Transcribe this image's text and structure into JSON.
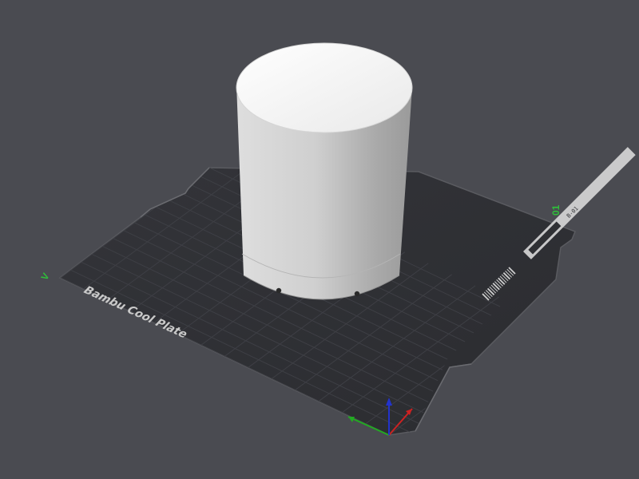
{
  "scene": {
    "plate": {
      "label": "Bambu Cool Plate",
      "corner_id_top": "01",
      "corner_id_left": "V",
      "side_code": "B-01"
    },
    "model": {
      "shape": "cylinder",
      "vent_holes_visible": 2
    },
    "axes": {
      "x_color": "#cc2222",
      "y_color": "#22aa22",
      "z_color": "#2233cc"
    },
    "colors": {
      "background": "#4a4b51",
      "plate": "#2f3034",
      "plate_edge": "#5a5b60",
      "grid_line": "#3d3e43",
      "model_top": "#f4f4f4",
      "model_side": "#bdbdbd",
      "corner_label": "#2fbf3a"
    }
  }
}
